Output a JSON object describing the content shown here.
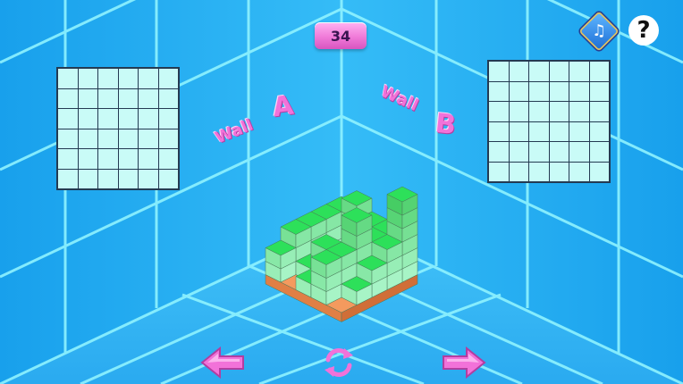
{
  "counter": {
    "value": "34"
  },
  "walls": {
    "a": {
      "word": "Wall",
      "letter": "A"
    },
    "b": {
      "word": "Wall",
      "letter": "B"
    }
  },
  "icons": {
    "music": "music-note-icon",
    "help": "question-mark-icon",
    "left": "arrow-left-icon",
    "right": "arrow-right-icon",
    "rotate": "rotate-icon"
  },
  "colors": {
    "background": "#1fa9f0",
    "wall_line": "#8ff3ff",
    "block_top": "#2de05a",
    "block_side": "#a9f5c8",
    "floor": "#f49a5e",
    "accent_pink": "#f272d9",
    "grid_cell": "#c9fbf7"
  },
  "board": {
    "grid_size": 5,
    "heights": [
      [
        3,
        3,
        3,
        3,
        2
      ],
      [
        4,
        0,
        0,
        1,
        0
      ],
      [
        3,
        1,
        1,
        3,
        1
      ],
      [
        3,
        3,
        5,
        3,
        3
      ],
      [
        6,
        3,
        2,
        1,
        0
      ]
    ]
  }
}
